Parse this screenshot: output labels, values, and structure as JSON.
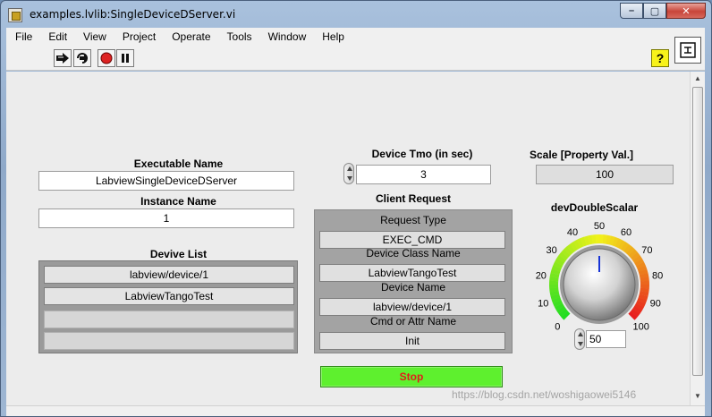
{
  "window": {
    "title": "examples.lvlib:SingleDeviceDServer.vi",
    "controls": {
      "minimize": "–",
      "maximize": "▢",
      "close": "✕"
    }
  },
  "menu": [
    "File",
    "Edit",
    "View",
    "Project",
    "Operate",
    "Tools",
    "Window",
    "Help"
  ],
  "toolbar": {
    "buttons": [
      "run-arrow-icon",
      "run-continuously-icon",
      "abort-icon",
      "pause-icon"
    ],
    "help_label": "?"
  },
  "front_panel": {
    "executable_name": {
      "label": "Executable Name",
      "value": "LabviewSingleDeviceDServer"
    },
    "instance_name": {
      "label": "Instance Name",
      "value": "1"
    },
    "device_list": {
      "label": "Devive List",
      "items": [
        "labview/device/1",
        "LabviewTangoTest",
        "",
        ""
      ]
    },
    "device_tmo": {
      "label": "Device Tmo (in sec)",
      "value": "3"
    },
    "client_request": {
      "label": "Client Request",
      "request_type_label": "Request Type",
      "request_type_value": "EXEC_CMD",
      "device_class_label": "Device Class Name",
      "device_class_value": "LabviewTangoTest",
      "device_name_label": "Device Name",
      "device_name_value": "labview/device/1",
      "cmd_attr_label": "Cmd or Attr Name",
      "cmd_attr_value": "Init"
    },
    "scale": {
      "label": "Scale  [Property Val.]",
      "value": "100"
    },
    "knob": {
      "label": "devDoubleScalar",
      "min": 0,
      "max": 100,
      "value": 50,
      "ticks": [
        "0",
        "10",
        "20",
        "30",
        "40",
        "50",
        "60",
        "70",
        "80",
        "90",
        "100"
      ],
      "digital_value": "50",
      "colors": {
        "low": "#22dd22",
        "mid": "#f2f21a",
        "high": "#e81e1e"
      }
    },
    "stop_button": {
      "label": "Stop",
      "color": "#5ef02e",
      "text_color": "#e21b1b"
    }
  },
  "watermark": "https://blog.csdn.net/woshigaowei5146"
}
